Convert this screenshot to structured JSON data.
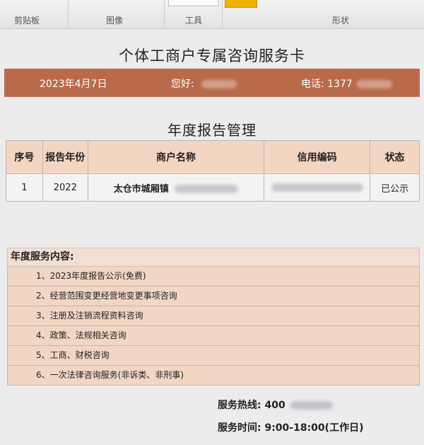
{
  "ribbon": {
    "groups": [
      "剪贴板",
      "图像",
      "工具",
      "形状"
    ],
    "accent_color": "#f0b000"
  },
  "card": {
    "title": "个体工商户专属咨询服务卡",
    "banner": {
      "date": "2023年4月7日",
      "greeting": "您好:",
      "phone_label": "电话:",
      "phone_value": "1377",
      "color": "#b96a4b"
    }
  },
  "report": {
    "title": "年度报告管理",
    "columns": [
      "序号",
      "报告年份",
      "商户名称",
      "信用编码",
      "状态"
    ],
    "rows": [
      {
        "no": "1",
        "year": "2022",
        "name": "太仓市城厢镇",
        "status": "已公示"
      }
    ]
  },
  "services": {
    "title": "年度服务内容:",
    "items": [
      "1、2023年度报告公示(免费)",
      "2、经营范围变更经营地变更事项咨询",
      "3、注册及注销流程资料咨询",
      "4、政策、法规相关咨询",
      "5、工商、财税咨询",
      "6、一次法律咨询服务(非诉类、非刑事)"
    ]
  },
  "footer": {
    "hotline": "服务热线: 400",
    "hours": "服务时间: 9:00-18:00(工作日)"
  }
}
